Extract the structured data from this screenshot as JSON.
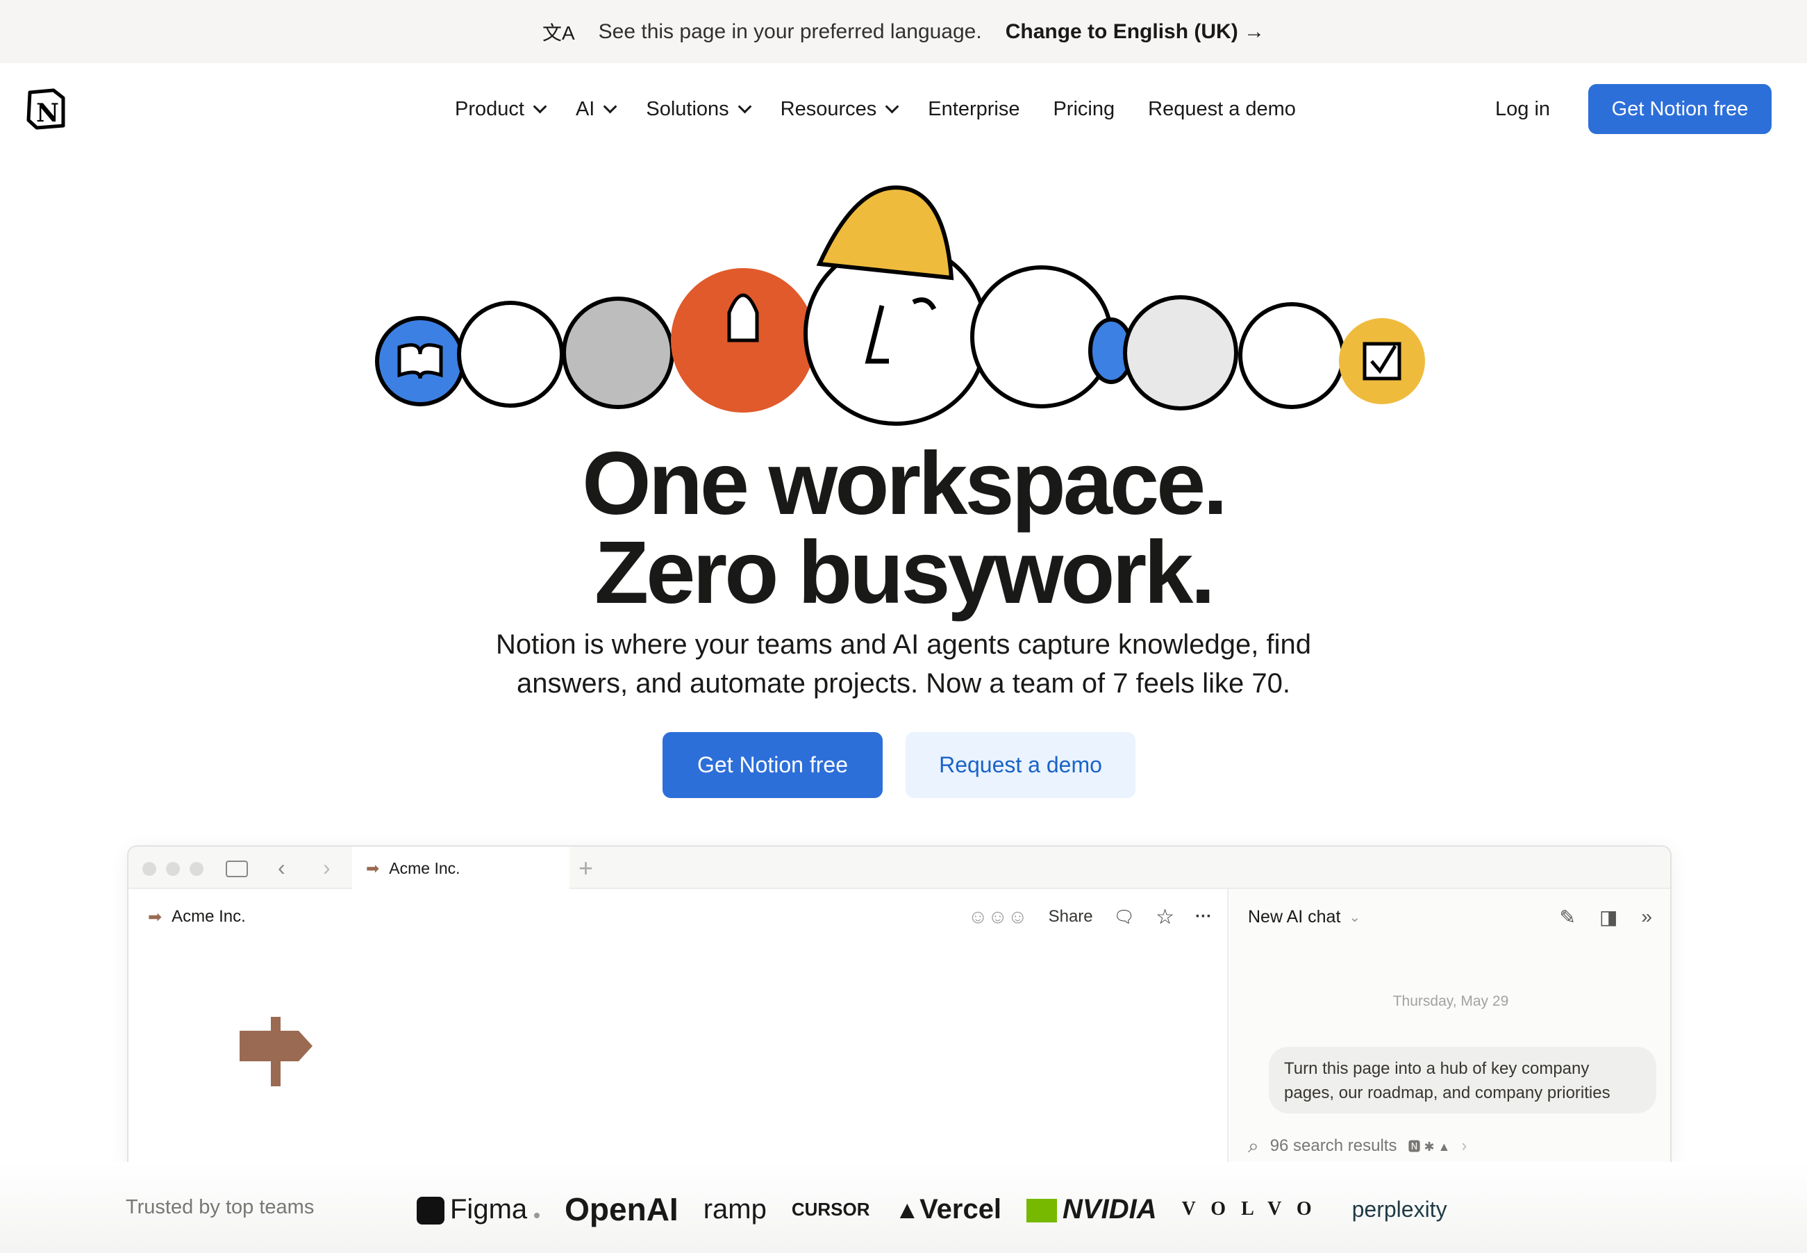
{
  "banner": {
    "message": "See this page in your preferred language.",
    "action": "Change to English (UK) →"
  },
  "nav": {
    "items": [
      {
        "label": "Product",
        "dropdown": true
      },
      {
        "label": "AI",
        "dropdown": true
      },
      {
        "label": "Solutions",
        "dropdown": true
      },
      {
        "label": "Resources",
        "dropdown": true
      },
      {
        "label": "Enterprise"
      },
      {
        "label": "Pricing"
      },
      {
        "label": "Request a demo"
      }
    ],
    "login": "Log in",
    "cta": "Get Notion free"
  },
  "hero": {
    "line1": "One workspace.",
    "line2": "Zero busywork.",
    "sub1": "Notion is where your teams and AI agents capture knowledge, find",
    "sub2": "answers, and automate projects. Now a team of 7 feels like 70.",
    "primary": "Get Notion free",
    "secondary": "Request a demo"
  },
  "app": {
    "tab": "Acme Inc.",
    "page_title": "Acme Inc.",
    "share": "Share",
    "ai_title": "New AI chat",
    "date": "Thursday, May 29",
    "prompt": "Turn this page into a hub of key company pages, our roadmap, and company priorities",
    "search_results": "96 search results"
  },
  "trusted": {
    "label": "Trusted by top teams",
    "logos": [
      "Figma",
      "OpenAI",
      "ramp",
      "CURSOR",
      "Vercel",
      "NVIDIA",
      "VOLVO",
      "perplexity"
    ]
  },
  "colors": {
    "accent": "#2d6fd9",
    "banner_bg": "#f6f5f4",
    "secondary_bg": "#eaf3fe",
    "sign": "#9a6a52"
  }
}
